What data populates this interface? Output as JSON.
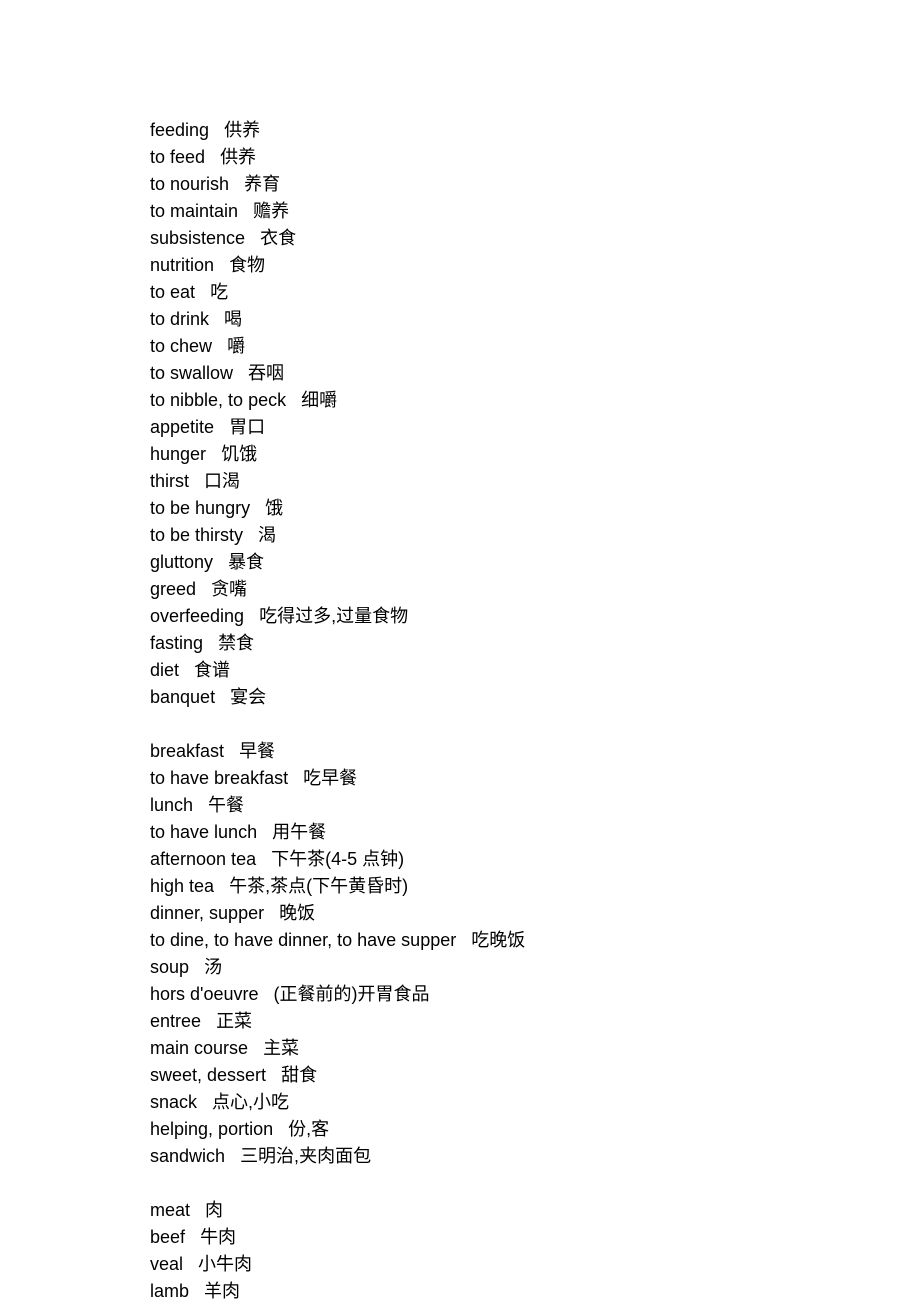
{
  "groups": [
    {
      "entries": [
        {
          "en": "feeding",
          "zh": "供养"
        },
        {
          "en": "to feed",
          "zh": "供养"
        },
        {
          "en": "to nourish",
          "zh": "养育"
        },
        {
          "en": "to maintain",
          "zh": "赡养"
        },
        {
          "en": "subsistence",
          "zh": "衣食"
        },
        {
          "en": "nutrition",
          "zh": "食物"
        },
        {
          "en": "to eat",
          "zh": "吃"
        },
        {
          "en": "to drink",
          "zh": "喝"
        },
        {
          "en": "to chew",
          "zh": "嚼"
        },
        {
          "en": "to swallow",
          "zh": "吞咽"
        },
        {
          "en": "to nibble, to peck",
          "zh": "细嚼"
        },
        {
          "en": "appetite",
          "zh": "胃口"
        },
        {
          "en": "hunger",
          "zh": "饥饿"
        },
        {
          "en": "thirst",
          "zh": "口渴"
        },
        {
          "en": "to be hungry",
          "zh": "饿"
        },
        {
          "en": "to be thirsty",
          "zh": "渴"
        },
        {
          "en": "gluttony",
          "zh": "暴食"
        },
        {
          "en": "greed",
          "zh": "贪嘴"
        },
        {
          "en": "overfeeding",
          "zh": "吃得过多,过量食物"
        },
        {
          "en": "fasting",
          "zh": "禁食"
        },
        {
          "en": "diet",
          "zh": "食谱"
        },
        {
          "en": "banquet",
          "zh": "宴会"
        }
      ]
    },
    {
      "entries": [
        {
          "en": "breakfast",
          "zh": "早餐"
        },
        {
          "en": "to have breakfast",
          "zh": "吃早餐"
        },
        {
          "en": "lunch",
          "zh": "午餐"
        },
        {
          "en": "to have lunch",
          "zh": "用午餐"
        },
        {
          "en": "afternoon tea",
          "zh": "下午茶(4-5 点钟)"
        },
        {
          "en": "high tea",
          "zh": "午茶,茶点(下午黄昏时)"
        },
        {
          "en": "dinner, supper",
          "zh": "晚饭"
        },
        {
          "en": "to dine, to have dinner, to have supper",
          "zh": "吃晚饭"
        },
        {
          "en": "soup",
          "zh": "汤"
        },
        {
          "en": "hors d'oeuvre",
          "zh": "(正餐前的)开胃食品"
        },
        {
          "en": "entree",
          "zh": "正菜"
        },
        {
          "en": "main course",
          "zh": "主菜"
        },
        {
          "en": "sweet, dessert",
          "zh": "甜食"
        },
        {
          "en": "snack",
          "zh": "点心,小吃"
        },
        {
          "en": "helping, portion",
          "zh": "份,客"
        },
        {
          "en": "sandwich",
          "zh": "三明治,夹肉面包"
        }
      ]
    },
    {
      "entries": [
        {
          "en": "meat",
          "zh": "肉"
        },
        {
          "en": "beef",
          "zh": "牛肉"
        },
        {
          "en": "veal",
          "zh": "小牛肉"
        },
        {
          "en": "lamb",
          "zh": "羊肉"
        }
      ]
    }
  ]
}
